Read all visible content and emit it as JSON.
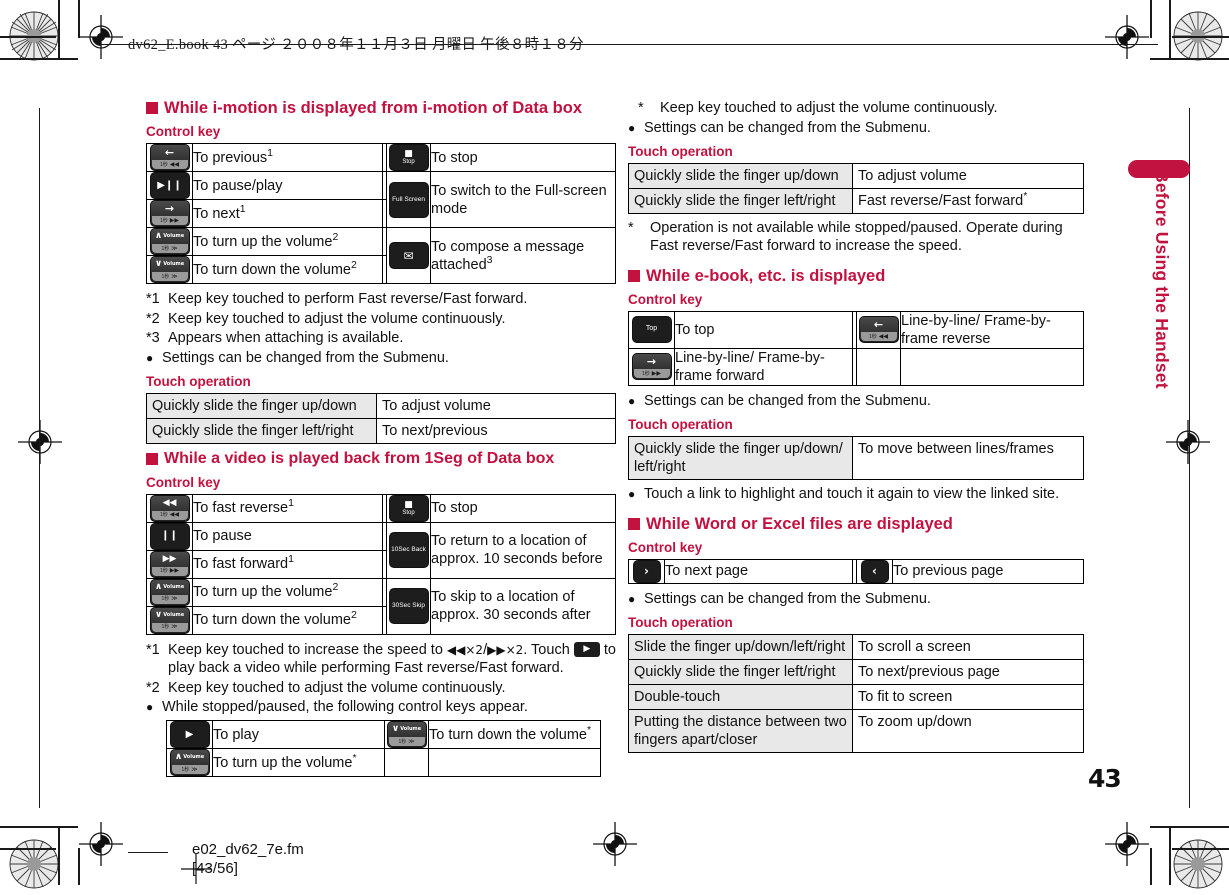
{
  "header": {
    "book_line": "dv62_E.book   43 ページ   ２００８年１１月３日   月曜日   午後８時１８分"
  },
  "footer": {
    "file_name": "e02_dv62_7e.fm",
    "page_of": "[43/56]"
  },
  "side": {
    "chapter_title": "Before Using the Handset",
    "page_number": "43"
  },
  "left_column": {
    "section1": {
      "heading": "While i-motion is displayed from i-motion of Data box",
      "control_key_label": "Control key",
      "control_rows": [
        {
          "icon": "previous-key",
          "glyph": "←",
          "sub": "1秒 ◀◀",
          "label": "To previous",
          "note": "1"
        },
        {
          "icon": "pause-play-key",
          "glyph": "▶❙❙",
          "sub": "",
          "label": "To pause/play",
          "note": ""
        },
        {
          "icon": "next-key",
          "glyph": "→",
          "sub": "1秒 ▶▶",
          "label": "To next",
          "note": "1"
        },
        {
          "icon": "volume-up-key",
          "glyph": "∧",
          "sub": "1秒 ≫",
          "label": "To turn up the volume",
          "note": "2"
        },
        {
          "icon": "volume-down-key",
          "glyph": "∨",
          "sub": "1秒 ≫",
          "label": "To turn down the volume",
          "note": "2"
        }
      ],
      "control_rows_right": [
        {
          "icon": "stop-key",
          "caption": "Stop",
          "label": "To stop",
          "note": ""
        },
        {
          "icon": "full-screen-key",
          "caption": "Full Screen",
          "label": "To switch to the Full-screen mode",
          "note": ""
        },
        {
          "icon": "compose-message-key",
          "caption": "✉",
          "label": "To compose a message attached",
          "note": "3"
        }
      ],
      "footnotes": [
        {
          "mark": "*1",
          "text": "Keep key touched to perform Fast reverse/Fast forward."
        },
        {
          "mark": "*2",
          "text": "Keep key touched to adjust the volume continuously."
        },
        {
          "mark": "*3",
          "text": "Appears when attaching is available."
        },
        {
          "mark": "●",
          "text": "Settings can be changed from the Submenu."
        }
      ],
      "touch_operation_label": "Touch operation",
      "touch_rows": [
        {
          "action": "Quickly slide the finger up/down",
          "result": "To adjust volume"
        },
        {
          "action": "Quickly slide the finger left/right",
          "result": "To next/previous"
        }
      ]
    },
    "section2": {
      "heading": "While a video is played back from 1Seg of Data box",
      "control_key_label": "Control key",
      "control_rows": [
        {
          "icon": "fast-reverse-key",
          "glyph": "◀◀",
          "sub": "1秒 ◀◀",
          "label": "To fast reverse",
          "note": "1"
        },
        {
          "icon": "pause-key",
          "glyph": "❙❙",
          "sub": "",
          "label": "To pause",
          "note": ""
        },
        {
          "icon": "fast-forward-key",
          "glyph": "▶▶",
          "sub": "1秒 ▶▶",
          "label": "To fast forward",
          "note": "1"
        },
        {
          "icon": "volume-up-key",
          "glyph": "∧",
          "sub": "1秒 ≫",
          "label": "To turn up the volume",
          "note": "2"
        },
        {
          "icon": "volume-down-key",
          "glyph": "∨",
          "sub": "1秒 ≫",
          "label": "To turn down the volume",
          "note": "2"
        }
      ],
      "control_rows_right": [
        {
          "icon": "stop-key",
          "caption": "Stop",
          "label": "To stop",
          "note": ""
        },
        {
          "icon": "ten-sec-back-key",
          "caption": "10Sec Back",
          "label": "To return to a location of approx. 10 seconds before",
          "note": ""
        },
        {
          "icon": "thirty-sec-skip-key",
          "caption": "30Sec Skip",
          "label": "To skip to a location of approx. 30 seconds after",
          "note": ""
        }
      ],
      "footnotes": [
        {
          "mark": "*1",
          "text_a": "Keep key touched to increase the speed to ",
          "speed_a": "◀◀×2",
          "sep": "/",
          "speed_b": "▶▶×2",
          "text_b": ". Touch ",
          "text_c": " to play back a video while performing Fast reverse/Fast forward."
        },
        {
          "mark": "*2",
          "text": "Keep key touched to adjust the volume continuously."
        },
        {
          "mark": "●",
          "text": "While stopped/paused, the following control keys appear."
        }
      ],
      "inner_rows": [
        {
          "icon": "play-key",
          "glyph": "▶",
          "label": "To play",
          "note": ""
        },
        {
          "icon": "volume-up-key",
          "glyph": "∧",
          "label": "To turn up the volume",
          "note": "*"
        }
      ],
      "inner_rows_right": [
        {
          "icon": "volume-down-key",
          "glyph": "∨",
          "label": "To turn down the volume",
          "note": "*"
        }
      ]
    }
  },
  "right_column": {
    "top_notes": [
      {
        "mark": "*",
        "text": "Keep key touched to adjust the volume continuously."
      },
      {
        "mark": "●",
        "text": "Settings can be changed from the Submenu."
      }
    ],
    "touch_operation_label": "Touch operation",
    "touch_rows": [
      {
        "action": "Quickly slide the finger up/down",
        "result": "To adjust volume",
        "note": ""
      },
      {
        "action": "Quickly slide the finger left/right",
        "result": "Fast reverse/Fast forward",
        "note": "*"
      }
    ],
    "after_touch_note": {
      "mark": "*",
      "text": "Operation is not available while stopped/paused. Operate during Fast reverse/Fast forward to increase the speed."
    },
    "section3": {
      "heading": "While e-book, etc. is displayed",
      "control_key_label": "Control key",
      "rows": [
        {
          "icon": "to-top-key",
          "caption": "Top",
          "label": "To top"
        },
        {
          "icon": "line-forward-key",
          "glyph": "→",
          "sub": "1秒 ▶▶",
          "label": "Line-by-line/ Frame-by-frame forward"
        }
      ],
      "rows_right": [
        {
          "icon": "line-reverse-key",
          "glyph": "←",
          "sub": "1秒 ◀◀",
          "label": "Line-by-line/ Frame-by-frame reverse"
        }
      ],
      "note": {
        "mark": "●",
        "text": "Settings can be changed from the Submenu."
      },
      "touch_operation_label": "Touch operation",
      "touch_rows": [
        {
          "action": "Quickly slide the finger up/down/ left/right",
          "result": "To move between lines/frames"
        }
      ],
      "link_note": {
        "mark": "●",
        "text": "Touch a link to highlight and touch it again to view the linked site."
      }
    },
    "section4": {
      "heading": "While Word or Excel files are displayed",
      "control_key_label": "Control key",
      "rows": [
        {
          "icon": "next-page-key",
          "glyph": "›",
          "label": "To next page"
        }
      ],
      "rows_right": [
        {
          "icon": "previous-page-key",
          "glyph": "‹",
          "label": "To previous page"
        }
      ],
      "note": {
        "mark": "●",
        "text": "Settings can be changed from the Submenu."
      },
      "touch_operation_label": "Touch operation",
      "touch_rows": [
        {
          "action": "Slide the finger up/down/left/right",
          "result": "To scroll a screen"
        },
        {
          "action": "Quickly slide the finger left/right",
          "result": "To next/previous page"
        },
        {
          "action": "Double-touch",
          "result": "To fit to screen"
        },
        {
          "action": "Putting the distance between two fingers apart/closer",
          "result": "To zoom up/down"
        }
      ]
    }
  },
  "colors": {
    "accent": "#C2123F",
    "table_key_bg": "#e8e8e8",
    "text": "#111111"
  }
}
